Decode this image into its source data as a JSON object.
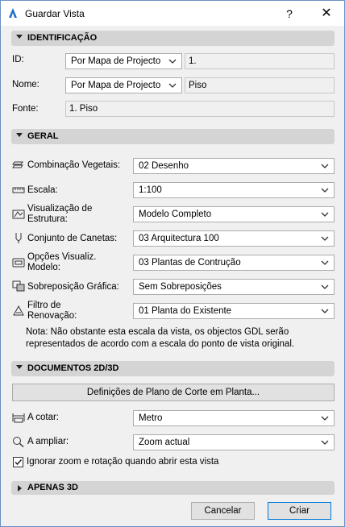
{
  "window": {
    "title": "Guardar Vista",
    "help_label": "?",
    "close_label": "✕"
  },
  "sections": {
    "identificacao": "IDENTIFICAÇÃO",
    "geral": "GERAL",
    "documentos": "DOCUMENTOS 2D/3D",
    "apenas3d": "APENAS 3D"
  },
  "identificacao": {
    "id_label": "ID:",
    "id_select": "Por Mapa de Projecto",
    "id_value": "1.",
    "nome_label": "Nome:",
    "nome_select": "Por Mapa de Projecto",
    "nome_value": "Piso",
    "fonte_label": "Fonte:",
    "fonte_value": "1. Piso"
  },
  "geral": {
    "combinacao_label": "Combinação Vegetais:",
    "combinacao_value": "02 Desenho",
    "escala_label": "Escala:",
    "escala_value": "1:100",
    "visualizacao_label_1": "Visualização de",
    "visualizacao_label_2": "Estrutura:",
    "visualizacao_value": "Modelo Completo",
    "canetas_label": "Conjunto de Canetas:",
    "canetas_value": "03 Arquitectura 100",
    "opcoes_label_1": "Opções Visualiz.",
    "opcoes_label_2": "Modelo:",
    "opcoes_value": "03 Plantas de Contrução",
    "sobreposicao_label": "Sobreposição Gráfica:",
    "sobreposicao_value": "Sem Sobreposições",
    "filtro_label_1": "Filtro de",
    "filtro_label_2": "Renovação:",
    "filtro_value": "01 Planta do Existente",
    "note_line_1": "Nota: Não obstante esta escala da vista, os objectos GDL serão",
    "note_line_2": "representados de acordo com a escala do ponto de vista original."
  },
  "documentos": {
    "plano_button": "Definições de Plano de Corte em Planta...",
    "cotar_label": "A cotar:",
    "cotar_value": "Metro",
    "ampliar_label": "A ampliar:",
    "ampliar_value": "Zoom actual",
    "ignorar_label": "Ignorar zoom e rotação quando abrir esta vista",
    "ignorar_checked": true
  },
  "footer": {
    "cancel_label": "Cancelar",
    "create_label": "Criar"
  },
  "colors": {
    "accent": "#0078d7",
    "section_bg": "#d4d4d4",
    "window_bg": "#f0f0f0"
  }
}
